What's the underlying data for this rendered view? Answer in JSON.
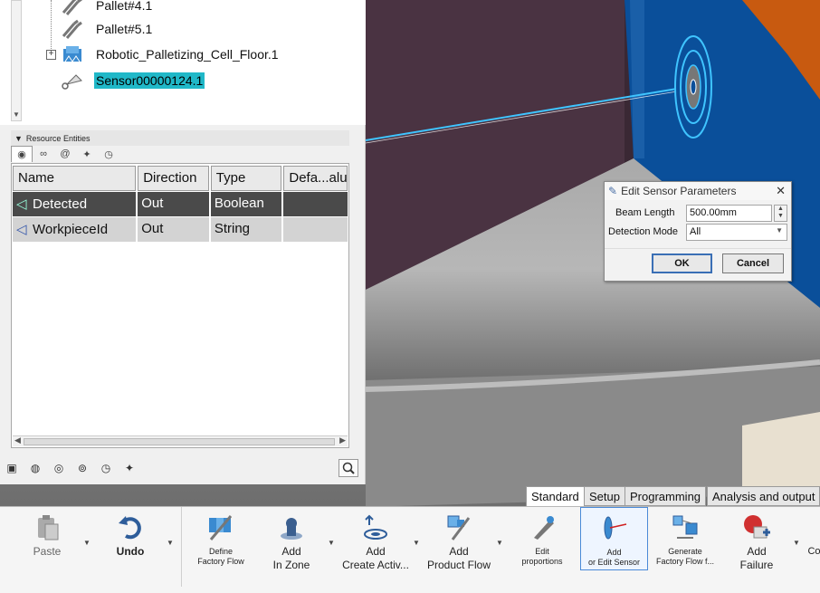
{
  "tree": {
    "items": [
      {
        "label": "Pallet#4.1",
        "icon": "pallet-icon"
      },
      {
        "label": "Pallet#5.1",
        "icon": "pallet-icon"
      },
      {
        "label": "Robotic_Palletizing_Cell_Floor.1",
        "icon": "floor-product-icon"
      },
      {
        "label": "Sensor00000124.1",
        "icon": "sensor-icon",
        "selected": true
      }
    ]
  },
  "resource_entities": {
    "header": "Resource Entities",
    "tabs": [
      "io-icon",
      "infinity-icon",
      "spiral-icon",
      "wand-icon",
      "timer-icon"
    ],
    "columns": [
      "Name",
      "Direction",
      "Type",
      "Defa...alu"
    ],
    "rows": [
      {
        "name": "Detected",
        "direction": "Out",
        "type": "Boolean",
        "default": ""
      },
      {
        "name": "WorkpieceId",
        "direction": "Out",
        "type": "String",
        "default": ""
      }
    ]
  },
  "panel_tools": [
    "add-entity-icon",
    "add-output-icon",
    "add-group-icon",
    "add-variable-icon",
    "add-timer-icon",
    "add-wand-icon",
    "search-icon"
  ],
  "dialog": {
    "title": "Edit Sensor Parameters",
    "beam_length_label": "Beam Length",
    "beam_length_value": "500.00mm",
    "detection_mode_label": "Detection Mode",
    "detection_mode_value": "All",
    "ok_label": "OK",
    "cancel_label": "Cancel"
  },
  "ribbon": {
    "tabs": [
      "Standard",
      "Setup",
      "Programming",
      "Analysis and output"
    ],
    "active_tab": "Standard",
    "buttons": [
      {
        "label": "Paste",
        "icon": "paste-icon"
      },
      {
        "label": "Undo",
        "icon": "undo-icon"
      },
      {
        "label": "Define\nFactory Flow",
        "icon": "define-factory-flow-icon"
      },
      {
        "label": "Add\nIn Zone",
        "icon": "add-in-zone-icon"
      },
      {
        "label": "Add\nCreate Activ...",
        "icon": "add-create-activity-icon"
      },
      {
        "label": "Add\nProduct Flow",
        "icon": "add-product-flow-icon"
      },
      {
        "label": "Edit\nproportions",
        "icon": "edit-proportions-icon"
      },
      {
        "label": "Add\nor Edit Sensor",
        "icon": "add-edit-sensor-icon"
      },
      {
        "label": "Generate\nFactory Flow f...",
        "icon": "generate-factory-flow-icon"
      },
      {
        "label": "Add\nFailure",
        "icon": "add-failure-icon"
      },
      {
        "label": "Co",
        "icon": ""
      }
    ]
  },
  "colors": {
    "selection": "#20b8c8",
    "beam": "#3fc4ff",
    "conveyor_blue": "#0a4f9a",
    "orange": "#c85a10",
    "purple_wall": "#4a3342"
  }
}
